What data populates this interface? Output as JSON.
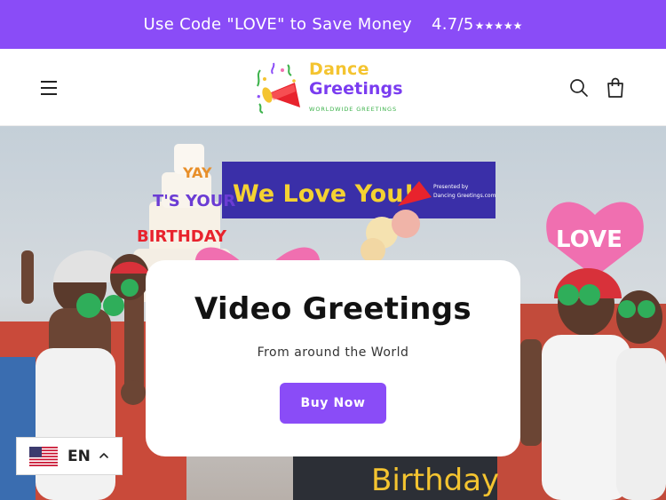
{
  "announcement": {
    "text": "Use Code \"LOVE\" to Save Money",
    "rating": "4.7/5",
    "stars": "★★★★★"
  },
  "header": {
    "logo": {
      "word1": "Dance",
      "word2": "Greetings",
      "tagline": "WORLDWIDE GREETINGS"
    },
    "icons": [
      "menu-icon",
      "search-icon",
      "cart-icon"
    ]
  },
  "hero": {
    "title": "Video Greetings",
    "subtitle": "From around the World",
    "button_label": "Buy Now",
    "photo_signs": {
      "banner": "We Love You!",
      "banner_small": "Presented by\nDancing Greetings.com",
      "cake": "YAY IT'S YOUR BIRTHDAY",
      "heart_left": "LOVE",
      "heart_right": "LOVE",
      "board": "Birthday"
    }
  },
  "language": {
    "code": "EN",
    "flag": "us-flag"
  },
  "colors": {
    "brand_purple": "#8a4cf7",
    "logo_yellow": "#f4c430",
    "logo_green": "#3bb24a",
    "heart_pink": "#f06fb0"
  }
}
